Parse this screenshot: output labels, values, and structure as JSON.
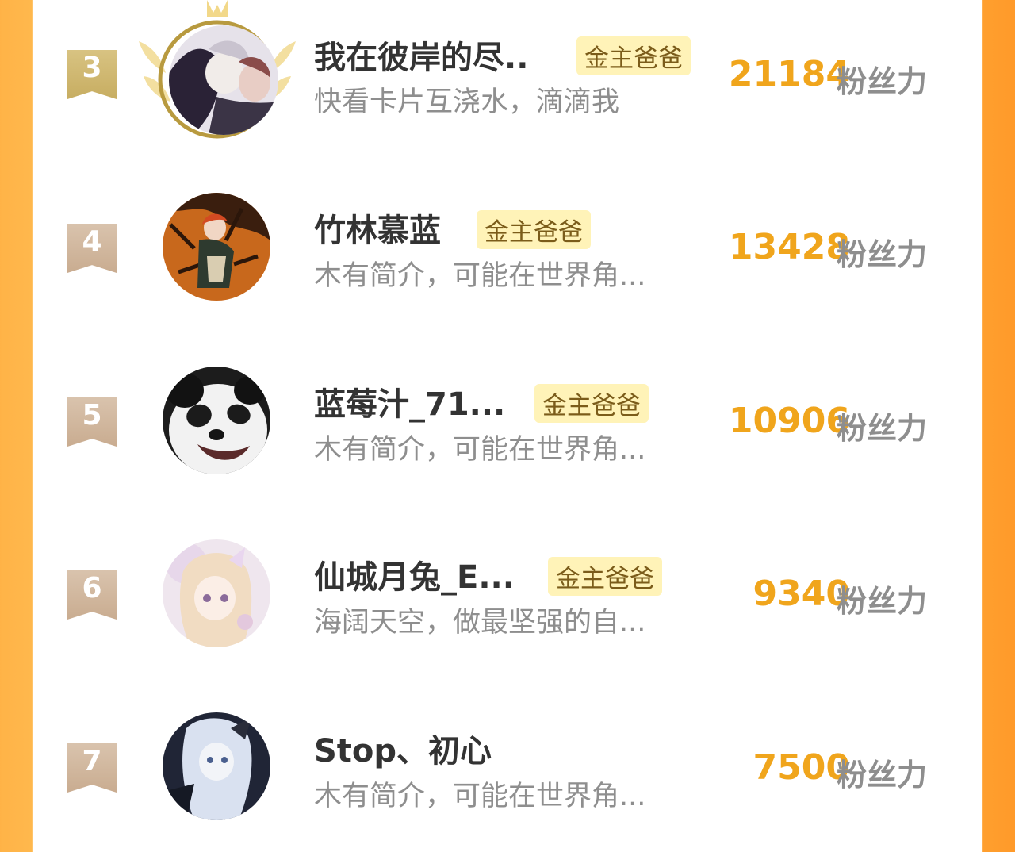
{
  "list": [
    {
      "rank": "3",
      "name": "我在彼岸的尽..",
      "tag": "金主爸爸",
      "desc": "快看卡片互浇水，滴滴我",
      "score": "21184",
      "unit": "粉丝力"
    },
    {
      "rank": "4",
      "name": "竹林慕蓝",
      "tag": "金主爸爸",
      "desc": "木有简介，可能在世界角...",
      "score": "13428",
      "unit": "粉丝力"
    },
    {
      "rank": "5",
      "name": "蓝莓汁_71...",
      "tag": "金主爸爸",
      "desc": "木有简介，可能在世界角...",
      "score": "10906",
      "unit": "粉丝力"
    },
    {
      "rank": "6",
      "name": "仙城月兔_E...",
      "tag": "金主爸爸",
      "desc": "海阔天空，做最坚强的自...",
      "score": "9340",
      "unit": "粉丝力"
    },
    {
      "rank": "7",
      "name": "Stop、初心",
      "tag": "",
      "desc": "木有简介，可能在世界角...",
      "score": "7500",
      "unit": "粉丝力"
    }
  ],
  "colors": {
    "accent": "#f0a51c",
    "tag_bg": "#fff3b8",
    "side_left": "#ffb347",
    "side_right": "#ff9a2a"
  }
}
